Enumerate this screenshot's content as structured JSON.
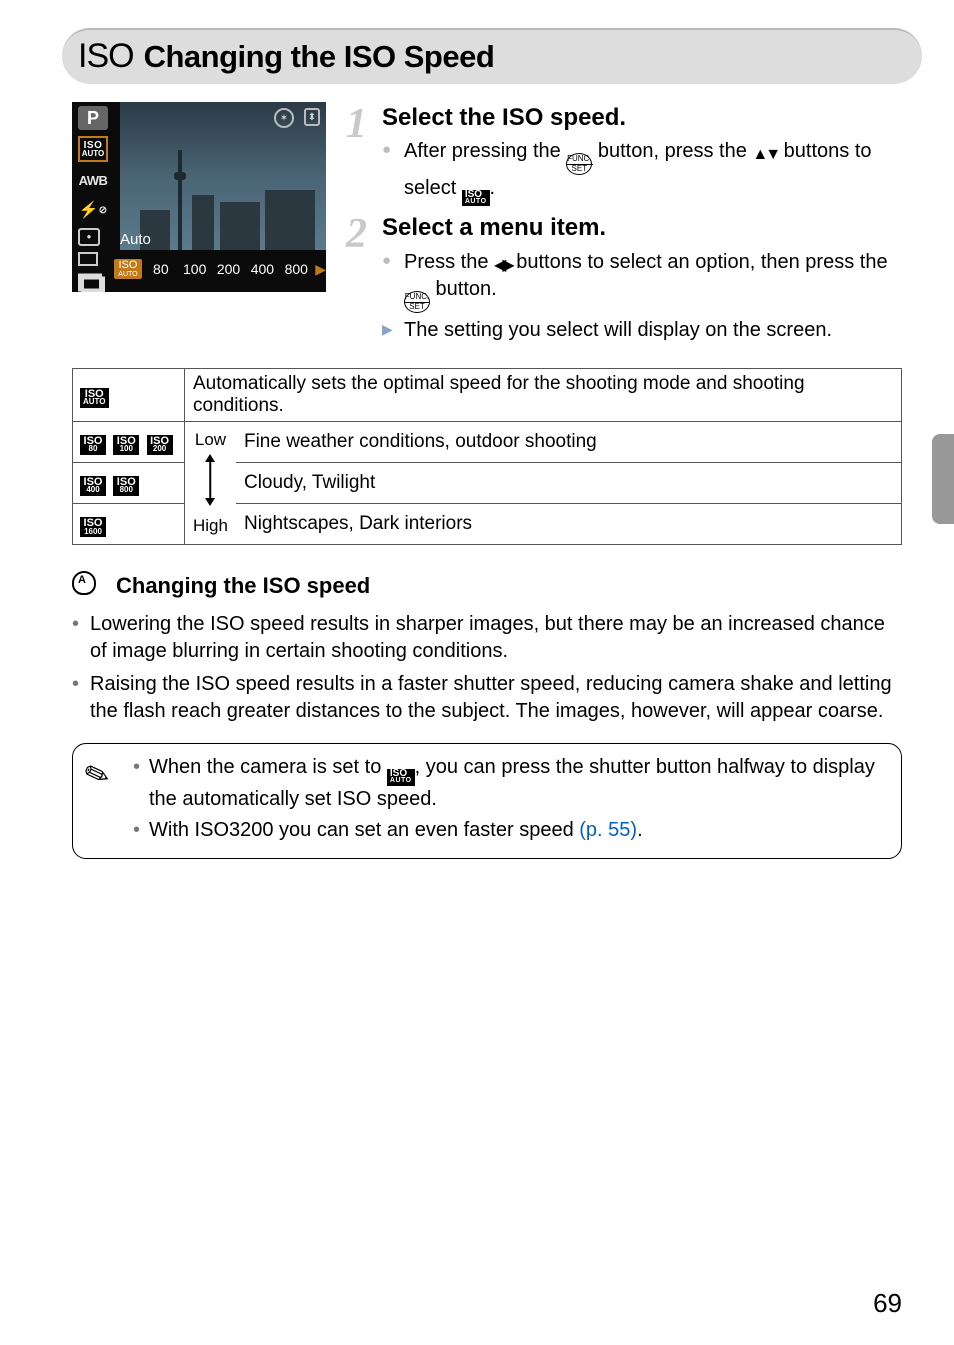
{
  "title": {
    "prefix": "ISO",
    "text": "Changing the ISO Speed"
  },
  "camera_ui": {
    "mode": "P",
    "left_icons": [
      "ISO/AUTO",
      "AWB",
      "flash-off",
      "evaluative-metering",
      "single-shot",
      "drive-single"
    ],
    "auto_label": "Auto",
    "strip": [
      "AUTO",
      "80",
      "100",
      "200",
      "400",
      "800"
    ],
    "top_right": [
      "stabilizer-icon",
      "orientation-icon"
    ]
  },
  "steps": [
    {
      "num": "1",
      "title": "Select the ISO speed.",
      "lines": [
        {
          "pre": "After pressing the ",
          "mid_icon": "func",
          "mid2": " button, press the ",
          "arrows": "ud",
          "post": " buttons to select ",
          "tail_icon": "iso-auto",
          "tail_post": "."
        }
      ]
    },
    {
      "num": "2",
      "title": "Select a menu item.",
      "lines": [
        {
          "pre": "Press the ",
          "arrows": "lr",
          "mid2": " buttons to select an option, then press the ",
          "mid_icon": "func",
          "post": " button."
        }
      ],
      "result": "The setting you select will display on the screen."
    }
  ],
  "table": {
    "row_auto": {
      "icons": [
        {
          "t": "ISO",
          "b": "AUTO"
        }
      ],
      "text": "Automatically sets the optimal speed for the shooting mode and shooting conditions."
    },
    "low_label": "Low",
    "high_label": "High",
    "rows": [
      {
        "icons": [
          {
            "t": "ISO",
            "b": "80"
          },
          {
            "t": "ISO",
            "b": "100"
          },
          {
            "t": "ISO",
            "b": "200"
          }
        ],
        "text": "Fine weather conditions, outdoor shooting"
      },
      {
        "icons": [
          {
            "t": "ISO",
            "b": "400"
          },
          {
            "t": "ISO",
            "b": "800"
          }
        ],
        "text": "Cloudy, Twilight"
      },
      {
        "icons": [
          {
            "t": "ISO",
            "b": "1600"
          }
        ],
        "text": "Nightscapes, Dark interiors"
      }
    ]
  },
  "tip": {
    "heading": "Changing the ISO speed",
    "items": [
      "Lowering the ISO speed results in sharper images, but there may be an increased chance of image blurring in certain shooting conditions.",
      "Raising the ISO speed results in a faster shutter speed, reducing camera shake and letting the flash reach greater distances to the subject. The images, however, will appear coarse."
    ]
  },
  "note": {
    "items": [
      {
        "pre": "When the camera is set to ",
        "icon": "iso-auto",
        "post": ", you can press the shutter button halfway to display the automatically set ISO speed."
      },
      {
        "pre": "With ISO3200 you can set an even faster speed ",
        "link": "(p. 55)",
        "post": "."
      }
    ]
  },
  "page_number": "69"
}
